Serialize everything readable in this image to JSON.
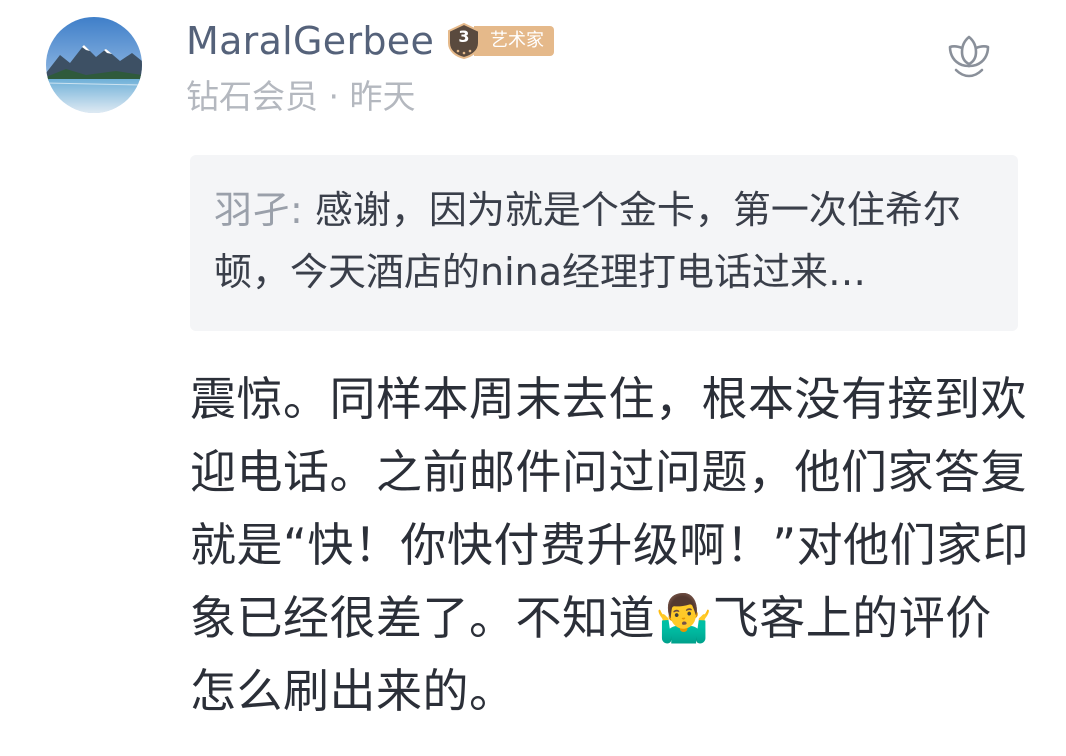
{
  "comment": {
    "author": {
      "name": "MaralGerbee",
      "level": "3",
      "title": "艺术家",
      "membership": "钻石会员",
      "separator": " · ",
      "time": "昨天"
    },
    "quote": {
      "author": "羽孑",
      "separator": ": ",
      "text": "感谢，因为就是个金卡，第一次住希尔顿，今天酒店的nina经理打电话过来…"
    },
    "body": "震惊。同样本周末去住，根本没有接到欢迎电话。之前邮件问过问题，他们家答复就是“快！你快付费升级啊！”对他们家印象已经很差了。不知道🤷‍♂️飞客上的评价怎么刷出来的。",
    "icons": {
      "avatar": "landscape-avatar",
      "badge": "level-shield-icon",
      "like": "lotus-like-icon"
    }
  },
  "colors": {
    "username": "#55627a",
    "meta": "#b4b8bf",
    "badge_bg": "#e5b98a",
    "badge_level_bg": "#5a4a3e",
    "quote_bg": "#f4f5f7",
    "body_text": "#2b2f38"
  }
}
